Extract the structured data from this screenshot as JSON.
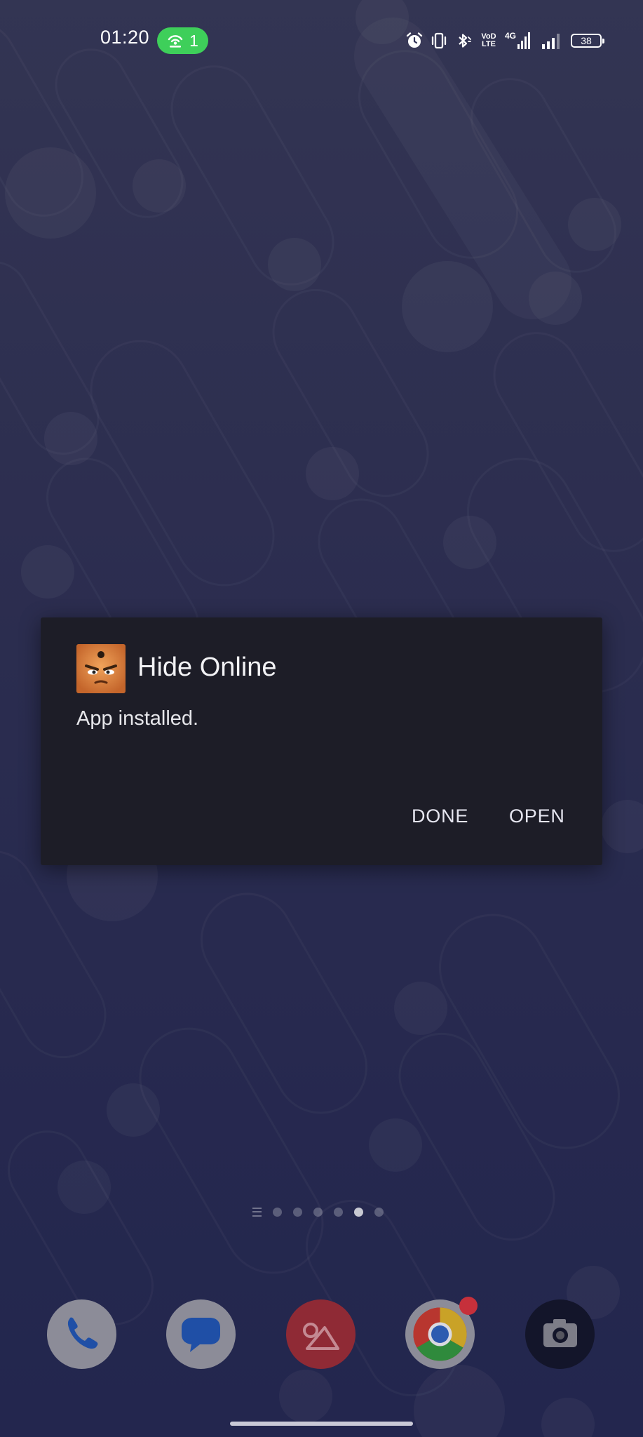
{
  "status_bar": {
    "time": "01:20",
    "hotspot_count": "1",
    "volte_line1": "VoD",
    "volte_line2": "LTE",
    "network_type": "4G",
    "battery_level": "38",
    "icons": [
      "alarm-icon",
      "vibrate-icon",
      "bluetooth-icon",
      "volte-icon",
      "signal-4g-icon",
      "signal-icon",
      "battery-icon"
    ]
  },
  "dialog": {
    "app_name": "Hide Online",
    "message": "App installed.",
    "done_label": "DONE",
    "open_label": "OPEN"
  },
  "home": {
    "page_count": 6,
    "active_page": 5
  },
  "dock": {
    "apps": [
      "phone",
      "messages",
      "gallery",
      "chrome",
      "camera"
    ],
    "chrome_has_badge": true
  },
  "colors": {
    "dialog_bg": "#1d1d27",
    "hotspot_green": "#3ecf5a",
    "badge_red": "#c6303b"
  }
}
